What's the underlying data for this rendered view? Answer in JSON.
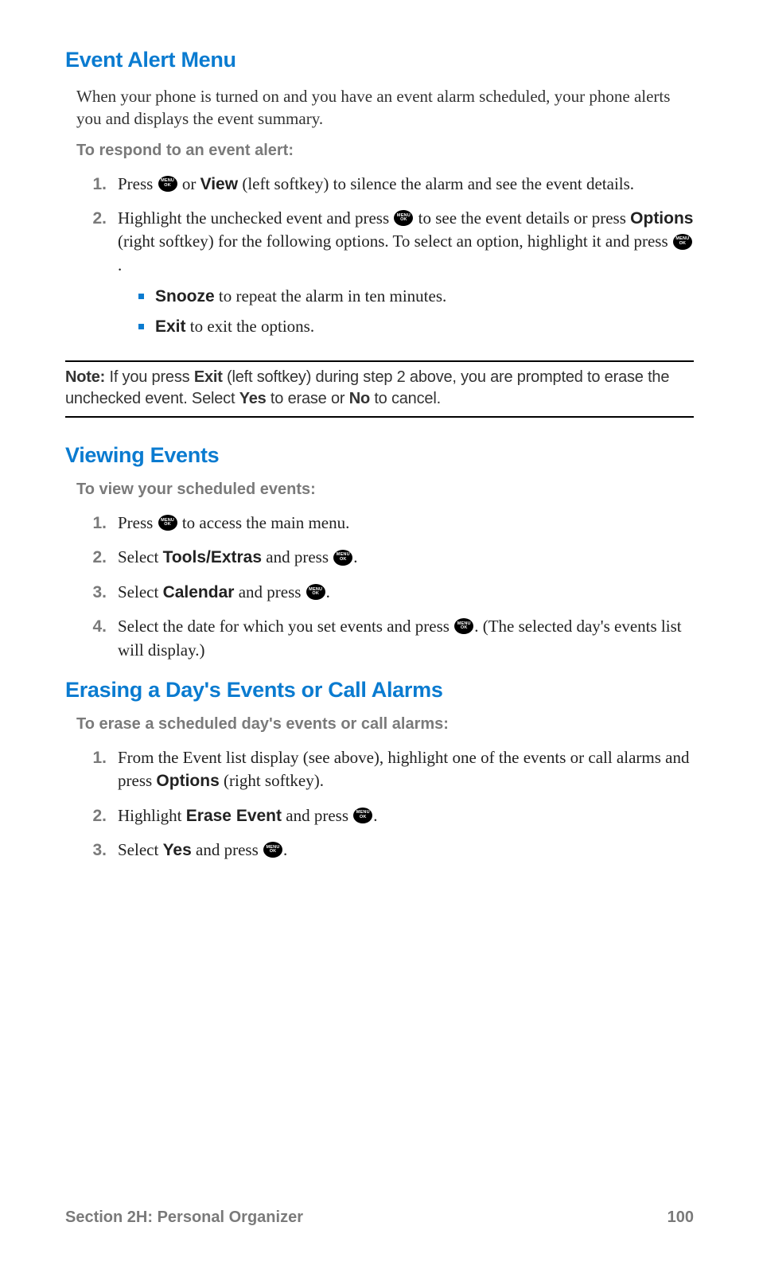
{
  "icon": {
    "top": "MENU",
    "bottom": "OK"
  },
  "s1": {
    "heading": "Event Alert Menu",
    "intro": "When your phone is turned on and you have an event alarm scheduled, your phone alerts you and displays the event summary.",
    "subintro": "To respond to an event alert:",
    "step1": {
      "num": "1.",
      "a": "Press ",
      "b": " or ",
      "view": "View",
      "c": " (left softkey) to silence the alarm and see the event details."
    },
    "step2": {
      "num": "2.",
      "a": "Highlight the unchecked event and press ",
      "b": " to see the event details or press ",
      "options": "Options",
      "c": " (right softkey) for the following options. To select an option, highlight it and press ",
      "d": ".",
      "bullet1_bold": "Snooze",
      "bullet1_rest": " to repeat the alarm in ten minutes.",
      "bullet2_bold": "Exit",
      "bullet2_rest": " to exit the options."
    }
  },
  "note": {
    "label": "Note:",
    "a": " If you press ",
    "exit": "Exit",
    "b": " (left softkey) during step 2 above, you are prompted to erase the unchecked event. Select ",
    "yes": "Yes",
    "c": " to erase or ",
    "no": "No",
    "d": " to cancel."
  },
  "s2": {
    "heading": "Viewing Events",
    "subintro": "To view your scheduled events:",
    "step1": {
      "num": "1.",
      "a": "Press ",
      "b": " to access the main menu."
    },
    "step2": {
      "num": "2.",
      "a": "Select ",
      "bold": "Tools/Extras",
      "b": " and press ",
      "c": "."
    },
    "step3": {
      "num": "3.",
      "a": "Select ",
      "bold": "Calendar",
      "b": " and press ",
      "c": "."
    },
    "step4": {
      "num": "4.",
      "a": "Select the date for which you set events and press ",
      "b": ". (The selected day's events list will display.)"
    }
  },
  "s3": {
    "heading": "Erasing a Day's Events or Call Alarms",
    "subintro": "To erase a scheduled day's events or call alarms:",
    "step1": {
      "num": "1.",
      "a": "From the Event list display (see above), highlight one of the events or call alarms and press ",
      "bold": "Options",
      "b": " (right softkey)."
    },
    "step2": {
      "num": "2.",
      "a": "Highlight ",
      "bold": "Erase Event",
      "b": " and press ",
      "c": "."
    },
    "step3": {
      "num": "3.",
      "a": "Select ",
      "bold": "Yes",
      "b": " and press ",
      "c": "."
    }
  },
  "footer": {
    "section": "Section 2H: Personal Organizer",
    "page": "100"
  }
}
